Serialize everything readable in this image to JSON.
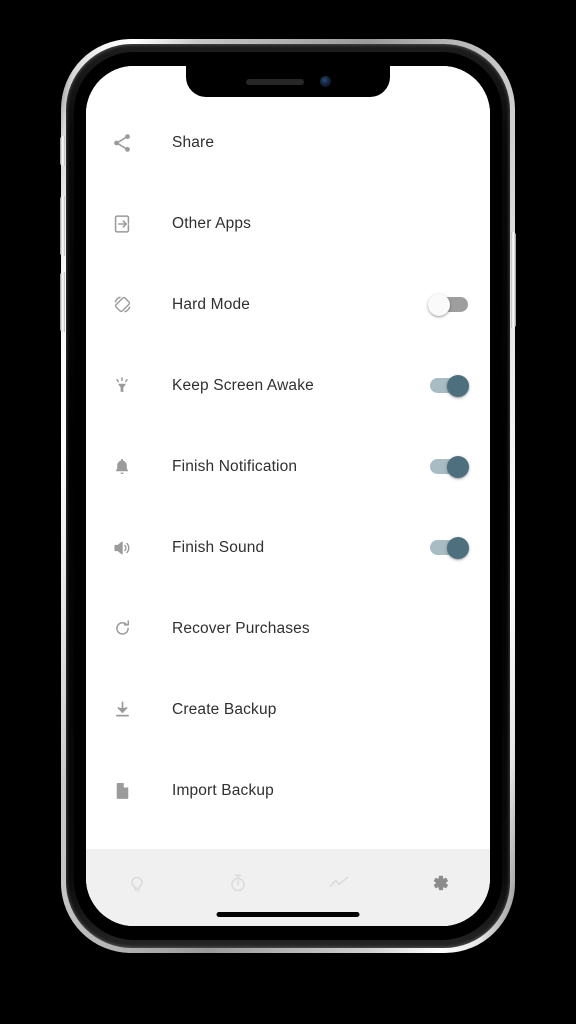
{
  "device": {
    "name": "iPhone X frame",
    "notch": {
      "speaker": "speaker-grille",
      "camera": "front-camera"
    },
    "home_indicator": "home-indicator"
  },
  "screen": {
    "background_color": "#ffffff",
    "settings": {
      "rows": [
        {
          "icon": "share-icon",
          "label": "Share",
          "control": "none"
        },
        {
          "icon": "open-in-app-icon",
          "label": "Other Apps",
          "control": "none"
        },
        {
          "icon": "screen-rotation-icon",
          "label": "Hard Mode",
          "control": "toggle",
          "value": "off"
        },
        {
          "icon": "brightness-icon",
          "label": "Keep Screen Awake",
          "control": "toggle",
          "value": "on"
        },
        {
          "icon": "bell-icon",
          "label": "Finish Notification",
          "control": "toggle",
          "value": "on"
        },
        {
          "icon": "volume-icon",
          "label": "Finish Sound",
          "control": "toggle",
          "value": "on"
        },
        {
          "icon": "refresh-icon",
          "label": "Recover Purchases",
          "control": "none"
        },
        {
          "icon": "download-icon",
          "label": "Create Backup",
          "control": "none"
        },
        {
          "icon": "document-icon",
          "label": "Import Backup",
          "control": "none"
        }
      ]
    },
    "tabbar": {
      "background_color": "#f0f0f0",
      "tabs": [
        {
          "icon": "lightbulb-icon",
          "name": "tab-ideas",
          "active": false
        },
        {
          "icon": "stopwatch-icon",
          "name": "tab-timer",
          "active": false
        },
        {
          "icon": "trending-icon",
          "name": "tab-stats",
          "active": false
        },
        {
          "icon": "gear-icon",
          "name": "tab-settings",
          "active": true
        }
      ]
    }
  },
  "colors": {
    "label_text": "#2f3032",
    "row_icon": "#9b9b9b",
    "toggle_on_track": "#a8bcc4",
    "toggle_on_knob": "#4d6f7e",
    "toggle_off_track": "#9e9e9e",
    "toggle_off_knob": "#fafafa",
    "tab_inactive": "#dcdcdc",
    "tab_active": "#8c8c8c"
  }
}
